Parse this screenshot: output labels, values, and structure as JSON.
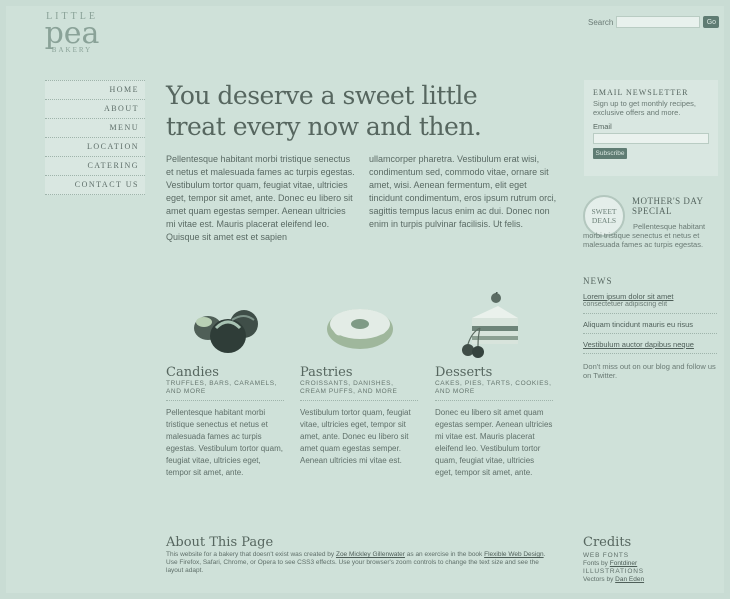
{
  "logo": {
    "line1": "LITTLE",
    "line2": "pea",
    "line3": "BAKERY"
  },
  "search": {
    "label": "Search",
    "button": "Go"
  },
  "nav": {
    "items": [
      "HOME",
      "ABOUT",
      "MENU",
      "LOCATION",
      "CATERING",
      "CONTACT US"
    ]
  },
  "headline": "You deserve a sweet little treat every now and then.",
  "intro": {
    "col1": "Pellentesque habitant morbi tristique senectus et netus et malesuada fames ac turpis egestas. Vestibulum tortor quam, feugiat vitae, ultricies eget, tempor sit amet, ante. Donec eu libero sit amet quam egestas semper. Aenean ultricies mi vitae est. Mauris placerat eleifend leo. Quisque sit amet est et sapien",
    "col2": "ullamcorper pharetra. Vestibulum erat wisi, condimentum sed, commodo vitae, ornare sit amet, wisi. Aenean fermentum, elit eget tincidunt condimentum, eros ipsum rutrum orci, sagittis tempus lacus enim ac dui. Donec non enim in turpis pulvinar facilisis. Ut felis."
  },
  "categories": [
    {
      "title": "Candies",
      "subtitle": "TRUFFLES, BARS, CARAMELS, AND MORE",
      "body": "Pellentesque habitant morbi tristique senectus et netus et malesuada fames ac turpis egestas. Vestibulum tortor quam, feugiat vitae, ultricies eget, tempor sit amet, ante."
    },
    {
      "title": "Pastries",
      "subtitle": "CROISSANTS, DANISHES, CREAM PUFFS, AND MORE",
      "body": "Vestibulum tortor quam, feugiat vitae, ultricies eget, tempor sit amet, ante. Donec eu libero sit amet quam egestas semper. Aenean ultricies mi vitae est."
    },
    {
      "title": "Desserts",
      "subtitle": "CAKES, PIES, TARTS, COOKIES, AND MORE",
      "body": "Donec eu libero sit amet quam egestas semper. Aenean ultricies mi vitae est. Mauris placerat eleifend leo. Vestibulum tortor quam, feugiat vitae, ultricies eget, tempor sit amet, ante."
    }
  ],
  "newsletter": {
    "title": "EMAIL NEWSLETTER",
    "text": "Sign up to get monthly recipes, exclusive offers and more.",
    "email_label": "Email",
    "button": "Subscribe"
  },
  "deal": {
    "badge_line1": "SWEET",
    "badge_line2": "DEALS",
    "title": "MOTHER'S DAY SPECIAL",
    "text": "Pellentesque habitant morbi tristique senectus et netus et malesuada fames ac turpis egestas."
  },
  "news": {
    "title": "NEWS",
    "items": [
      {
        "headline": "Lorem ipsum dolor sit amet",
        "sub": "consectetuer adipiscing elit"
      },
      {
        "headline": "Aliquam tincidunt mauris eu risus",
        "sub": ""
      },
      {
        "headline": "Vestibulum auctor dapibus neque",
        "sub": ""
      }
    ],
    "follow": "Don't miss out on our blog and follow us on Twitter."
  },
  "about": {
    "title": "About This Page",
    "text_before": "This website for a bakery that doesn't exist was created by ",
    "author": "Zoe Mickley Gillenwater",
    "text_mid": " as an exercise in the book ",
    "book": "Flexible Web Design",
    "text_after": ". Use Firefox, Safari, Chrome, or Opera to see CSS3 effects. Use your browser's zoom controls to change the text size and see the layout adapt."
  },
  "credits": {
    "title": "Credits",
    "web_fonts_label": "WEB FONTS",
    "web_fonts_text": "Fonts by ",
    "web_fonts_link": "Fontdiner",
    "illus_label": "ILLUSTRATIONS",
    "illus_text": "Vectors by ",
    "illus_link": "Dan Eden"
  }
}
